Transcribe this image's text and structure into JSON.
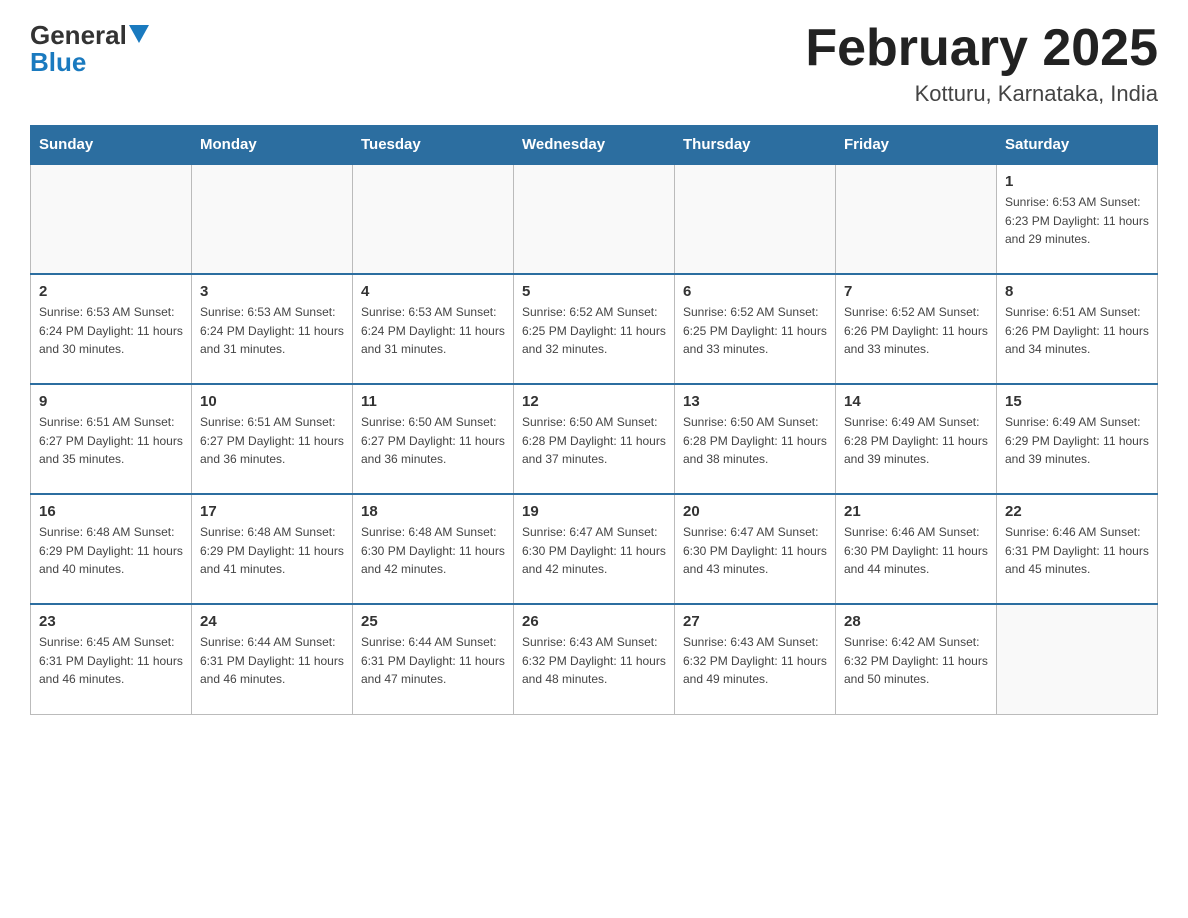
{
  "header": {
    "logo_general": "General",
    "logo_blue": "Blue",
    "month_title": "February 2025",
    "location": "Kotturu, Karnataka, India"
  },
  "weekdays": [
    "Sunday",
    "Monday",
    "Tuesday",
    "Wednesday",
    "Thursday",
    "Friday",
    "Saturday"
  ],
  "weeks": [
    [
      {
        "day": "",
        "info": ""
      },
      {
        "day": "",
        "info": ""
      },
      {
        "day": "",
        "info": ""
      },
      {
        "day": "",
        "info": ""
      },
      {
        "day": "",
        "info": ""
      },
      {
        "day": "",
        "info": ""
      },
      {
        "day": "1",
        "info": "Sunrise: 6:53 AM\nSunset: 6:23 PM\nDaylight: 11 hours\nand 29 minutes."
      }
    ],
    [
      {
        "day": "2",
        "info": "Sunrise: 6:53 AM\nSunset: 6:24 PM\nDaylight: 11 hours\nand 30 minutes."
      },
      {
        "day": "3",
        "info": "Sunrise: 6:53 AM\nSunset: 6:24 PM\nDaylight: 11 hours\nand 31 minutes."
      },
      {
        "day": "4",
        "info": "Sunrise: 6:53 AM\nSunset: 6:24 PM\nDaylight: 11 hours\nand 31 minutes."
      },
      {
        "day": "5",
        "info": "Sunrise: 6:52 AM\nSunset: 6:25 PM\nDaylight: 11 hours\nand 32 minutes."
      },
      {
        "day": "6",
        "info": "Sunrise: 6:52 AM\nSunset: 6:25 PM\nDaylight: 11 hours\nand 33 minutes."
      },
      {
        "day": "7",
        "info": "Sunrise: 6:52 AM\nSunset: 6:26 PM\nDaylight: 11 hours\nand 33 minutes."
      },
      {
        "day": "8",
        "info": "Sunrise: 6:51 AM\nSunset: 6:26 PM\nDaylight: 11 hours\nand 34 minutes."
      }
    ],
    [
      {
        "day": "9",
        "info": "Sunrise: 6:51 AM\nSunset: 6:27 PM\nDaylight: 11 hours\nand 35 minutes."
      },
      {
        "day": "10",
        "info": "Sunrise: 6:51 AM\nSunset: 6:27 PM\nDaylight: 11 hours\nand 36 minutes."
      },
      {
        "day": "11",
        "info": "Sunrise: 6:50 AM\nSunset: 6:27 PM\nDaylight: 11 hours\nand 36 minutes."
      },
      {
        "day": "12",
        "info": "Sunrise: 6:50 AM\nSunset: 6:28 PM\nDaylight: 11 hours\nand 37 minutes."
      },
      {
        "day": "13",
        "info": "Sunrise: 6:50 AM\nSunset: 6:28 PM\nDaylight: 11 hours\nand 38 minutes."
      },
      {
        "day": "14",
        "info": "Sunrise: 6:49 AM\nSunset: 6:28 PM\nDaylight: 11 hours\nand 39 minutes."
      },
      {
        "day": "15",
        "info": "Sunrise: 6:49 AM\nSunset: 6:29 PM\nDaylight: 11 hours\nand 39 minutes."
      }
    ],
    [
      {
        "day": "16",
        "info": "Sunrise: 6:48 AM\nSunset: 6:29 PM\nDaylight: 11 hours\nand 40 minutes."
      },
      {
        "day": "17",
        "info": "Sunrise: 6:48 AM\nSunset: 6:29 PM\nDaylight: 11 hours\nand 41 minutes."
      },
      {
        "day": "18",
        "info": "Sunrise: 6:48 AM\nSunset: 6:30 PM\nDaylight: 11 hours\nand 42 minutes."
      },
      {
        "day": "19",
        "info": "Sunrise: 6:47 AM\nSunset: 6:30 PM\nDaylight: 11 hours\nand 42 minutes."
      },
      {
        "day": "20",
        "info": "Sunrise: 6:47 AM\nSunset: 6:30 PM\nDaylight: 11 hours\nand 43 minutes."
      },
      {
        "day": "21",
        "info": "Sunrise: 6:46 AM\nSunset: 6:30 PM\nDaylight: 11 hours\nand 44 minutes."
      },
      {
        "day": "22",
        "info": "Sunrise: 6:46 AM\nSunset: 6:31 PM\nDaylight: 11 hours\nand 45 minutes."
      }
    ],
    [
      {
        "day": "23",
        "info": "Sunrise: 6:45 AM\nSunset: 6:31 PM\nDaylight: 11 hours\nand 46 minutes."
      },
      {
        "day": "24",
        "info": "Sunrise: 6:44 AM\nSunset: 6:31 PM\nDaylight: 11 hours\nand 46 minutes."
      },
      {
        "day": "25",
        "info": "Sunrise: 6:44 AM\nSunset: 6:31 PM\nDaylight: 11 hours\nand 47 minutes."
      },
      {
        "day": "26",
        "info": "Sunrise: 6:43 AM\nSunset: 6:32 PM\nDaylight: 11 hours\nand 48 minutes."
      },
      {
        "day": "27",
        "info": "Sunrise: 6:43 AM\nSunset: 6:32 PM\nDaylight: 11 hours\nand 49 minutes."
      },
      {
        "day": "28",
        "info": "Sunrise: 6:42 AM\nSunset: 6:32 PM\nDaylight: 11 hours\nand 50 minutes."
      },
      {
        "day": "",
        "info": ""
      }
    ]
  ]
}
